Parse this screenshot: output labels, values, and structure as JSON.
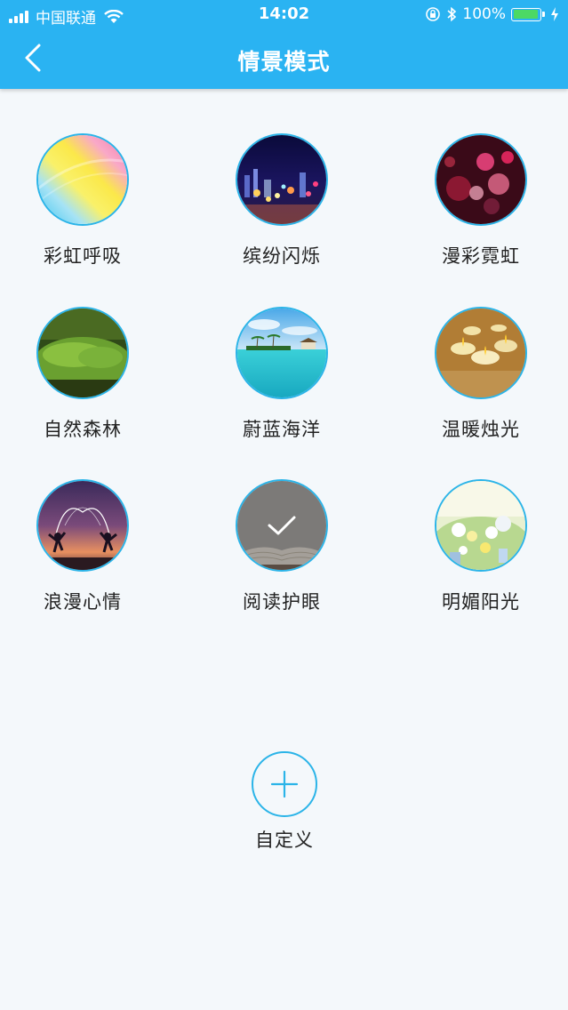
{
  "status_bar": {
    "carrier": "中国联通",
    "time": "14:02",
    "battery": "100%"
  },
  "nav": {
    "title": "情景模式"
  },
  "scenes": [
    {
      "label": "彩虹呼吸",
      "icon": "rainbow-image"
    },
    {
      "label": "缤纷闪烁",
      "icon": "city-lights-image"
    },
    {
      "label": "漫彩霓虹",
      "icon": "neon-bokeh-image"
    },
    {
      "label": "自然森林",
      "icon": "moss-forest-image"
    },
    {
      "label": "蔚蓝海洋",
      "icon": "blue-ocean-image"
    },
    {
      "label": "温暖烛光",
      "icon": "candlelight-image"
    },
    {
      "label": "浪漫心情",
      "icon": "romantic-silhouette-image"
    },
    {
      "label": "阅读护眼",
      "icon": "open-book-image",
      "selected": true
    },
    {
      "label": "明媚阳光",
      "icon": "sunny-flowers-image"
    }
  ],
  "custom": {
    "label": "自定义"
  },
  "colors": {
    "header": "#2ab3f2",
    "accent_border": "#2bb4e8",
    "battery_fill": "#4cd964"
  }
}
